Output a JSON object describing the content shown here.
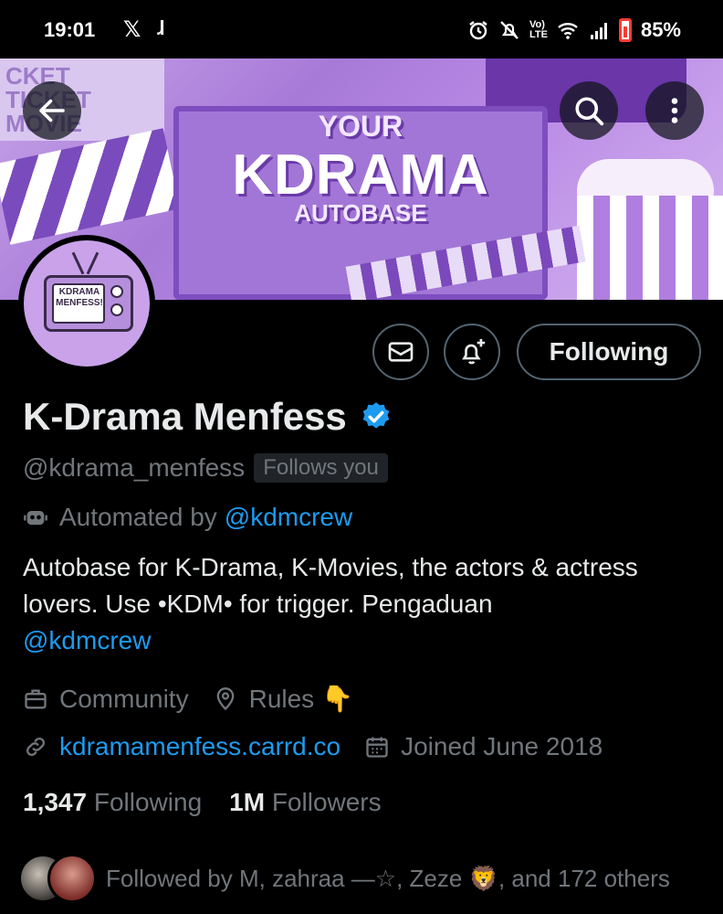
{
  "status_bar": {
    "time": "19:01",
    "battery": "85%",
    "left_icons": [
      "x-logo-icon",
      "j-app-icon"
    ],
    "right_icons": [
      "alarm-icon",
      "mute-icon",
      "volte-icon",
      "wifi-icon",
      "signal-icon",
      "battery-icon"
    ]
  },
  "banner": {
    "line1": "YOUR",
    "line2": "KDRAMA",
    "line3": "AUTOBASE",
    "ticket_text": "CKET\nTICKET\nMOVIE"
  },
  "avatar": {
    "tv_text": "KDRAMA MENFESS!"
  },
  "actions": {
    "following_label": "Following"
  },
  "profile": {
    "name": "K-Drama Menfess",
    "verified": true,
    "handle": "@kdrama_menfess",
    "follows_you": "Follows you",
    "automated_prefix": "Automated by",
    "automated_by": "@kdmcrew",
    "bio_text": "Autobase for K-Drama, K-Movies, the actors & actress lovers. Use •KDM• for trigger. Pengaduan",
    "bio_mention": "@kdmcrew",
    "category": "Community",
    "location": "Rules 👇",
    "website": "kdramamenfess.carrd.co",
    "joined": "Joined June 2018"
  },
  "stats": {
    "following_count": "1,347",
    "following_label": "Following",
    "followers_count": "1M",
    "followers_label": "Followers"
  },
  "followed_by": "Followed by M, zahraa —☆, Zeze 🦁, and 172 others",
  "colors": {
    "background": "#000000",
    "link": "#1d9bf0",
    "muted": "#71767b",
    "verified": "#1d9bf0",
    "banner": "#b98ae5"
  }
}
